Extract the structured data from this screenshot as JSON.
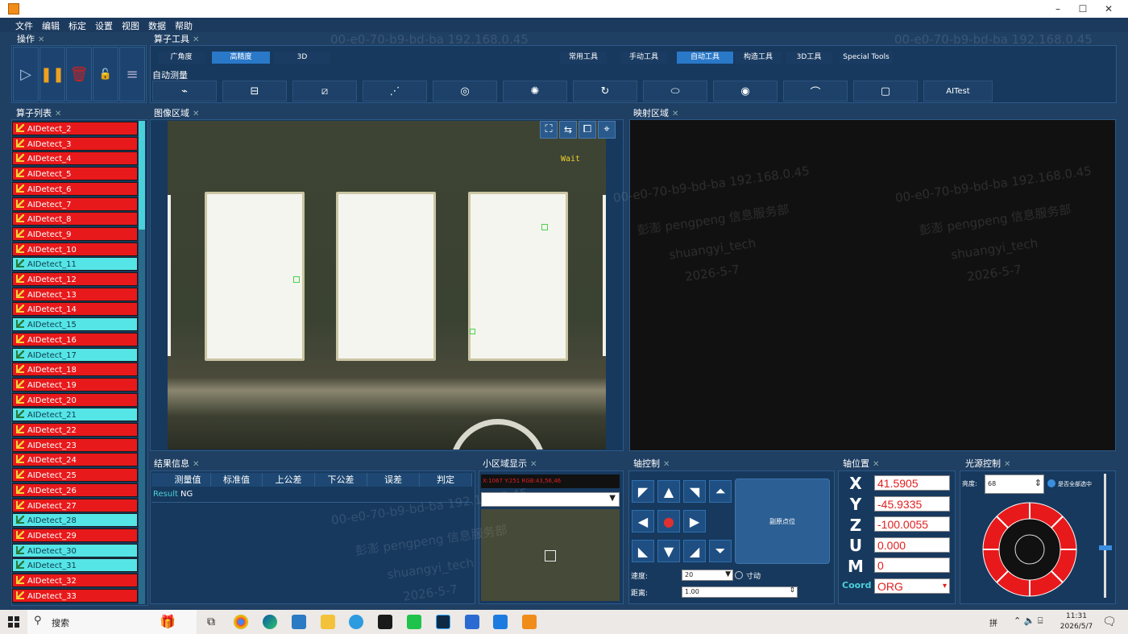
{
  "menu": [
    "文件",
    "编辑",
    "标定",
    "设置",
    "视图",
    "数据",
    "帮助"
  ],
  "panels": {
    "operation": "操作",
    "operator_tools": "算子工具",
    "operator_list": "算子列表",
    "image_area": "图像区域",
    "mapping_area": "映射区域",
    "result_info": "结果信息",
    "small_area": "小区域显示",
    "axis_control": "轴控制",
    "axis_position": "轴位置",
    "light_control": "光源控制"
  },
  "tool_modes": [
    "广角度",
    "高精度",
    "3D"
  ],
  "tool_tabs": [
    "常用工具",
    "手动工具",
    "自动工具",
    "构造工具",
    "3D工具",
    "Special Tools"
  ],
  "auto_measure_label": "自动测量",
  "aitest_label": "AITest",
  "detect_list": [
    {
      "label": "AIDetect_2",
      "color": "red"
    },
    {
      "label": "AIDetect_3",
      "color": "red"
    },
    {
      "label": "AIDetect_4",
      "color": "red"
    },
    {
      "label": "AIDetect_5",
      "color": "red"
    },
    {
      "label": "AIDetect_6",
      "color": "red"
    },
    {
      "label": "AIDetect_7",
      "color": "red"
    },
    {
      "label": "AIDetect_8",
      "color": "red"
    },
    {
      "label": "AIDetect_9",
      "color": "red"
    },
    {
      "label": "AIDetect_10",
      "color": "red"
    },
    {
      "label": "AIDetect_11",
      "color": "cyan"
    },
    {
      "label": "AIDetect_12",
      "color": "red"
    },
    {
      "label": "AIDetect_13",
      "color": "red"
    },
    {
      "label": "AIDetect_14",
      "color": "red"
    },
    {
      "label": "AIDetect_15",
      "color": "cyan"
    },
    {
      "label": "AIDetect_16",
      "color": "red"
    },
    {
      "label": "AIDetect_17",
      "color": "cyan"
    },
    {
      "label": "AIDetect_18",
      "color": "red"
    },
    {
      "label": "AIDetect_19",
      "color": "red"
    },
    {
      "label": "AIDetect_20",
      "color": "red"
    },
    {
      "label": "AIDetect_21",
      "color": "cyan"
    },
    {
      "label": "AIDetect_22",
      "color": "red"
    },
    {
      "label": "AIDetect_23",
      "color": "red"
    },
    {
      "label": "AIDetect_24",
      "color": "red"
    },
    {
      "label": "AIDetect_25",
      "color": "red"
    },
    {
      "label": "AIDetect_26",
      "color": "red"
    },
    {
      "label": "AIDetect_27",
      "color": "red"
    },
    {
      "label": "AIDetect_28",
      "color": "cyan"
    },
    {
      "label": "AIDetect_29",
      "color": "red"
    },
    {
      "label": "AIDetect_30",
      "color": "cyan"
    },
    {
      "label": "AIDetect_31",
      "color": "cyan"
    },
    {
      "label": "AIDetect_32",
      "color": "red"
    },
    {
      "label": "AIDetect_33",
      "color": "red"
    }
  ],
  "image": {
    "status": "Wait"
  },
  "result_table": {
    "headers": [
      "测量值",
      "标准值",
      "上公差",
      "下公差",
      "误差",
      "判定"
    ],
    "row_label": "Result",
    "row_value": "NG"
  },
  "small_area": {
    "readout": "X:1067 Y:251 RGB:43,56,46"
  },
  "axis_control": {
    "home_label": "副原点位",
    "speed_label": "速度:",
    "speed_value": "20",
    "inch_label": "寸动",
    "distance_label": "距离:",
    "distance_value": "1.00"
  },
  "axis_position": {
    "X": "41.5905",
    "Y": "-45.9335",
    "Z": "-100.0055",
    "U": "0.000",
    "M": "0",
    "coord_label": "Coord",
    "coord_value": "ORG"
  },
  "light_control": {
    "brightness_label": "亮度:",
    "brightness_value": "68",
    "check_label": "是否全部选中"
  },
  "watermark": {
    "line1": "00-e0-70-b9-bd-ba 192.168.0.45",
    "line2": "彭澎 pengpeng 信息服务部",
    "line3": "shuangyi_tech",
    "line4": "2026-5-7"
  },
  "taskbar": {
    "search": "搜索",
    "time": "11:31",
    "date": "2026/5/7",
    "ime": "拼"
  }
}
